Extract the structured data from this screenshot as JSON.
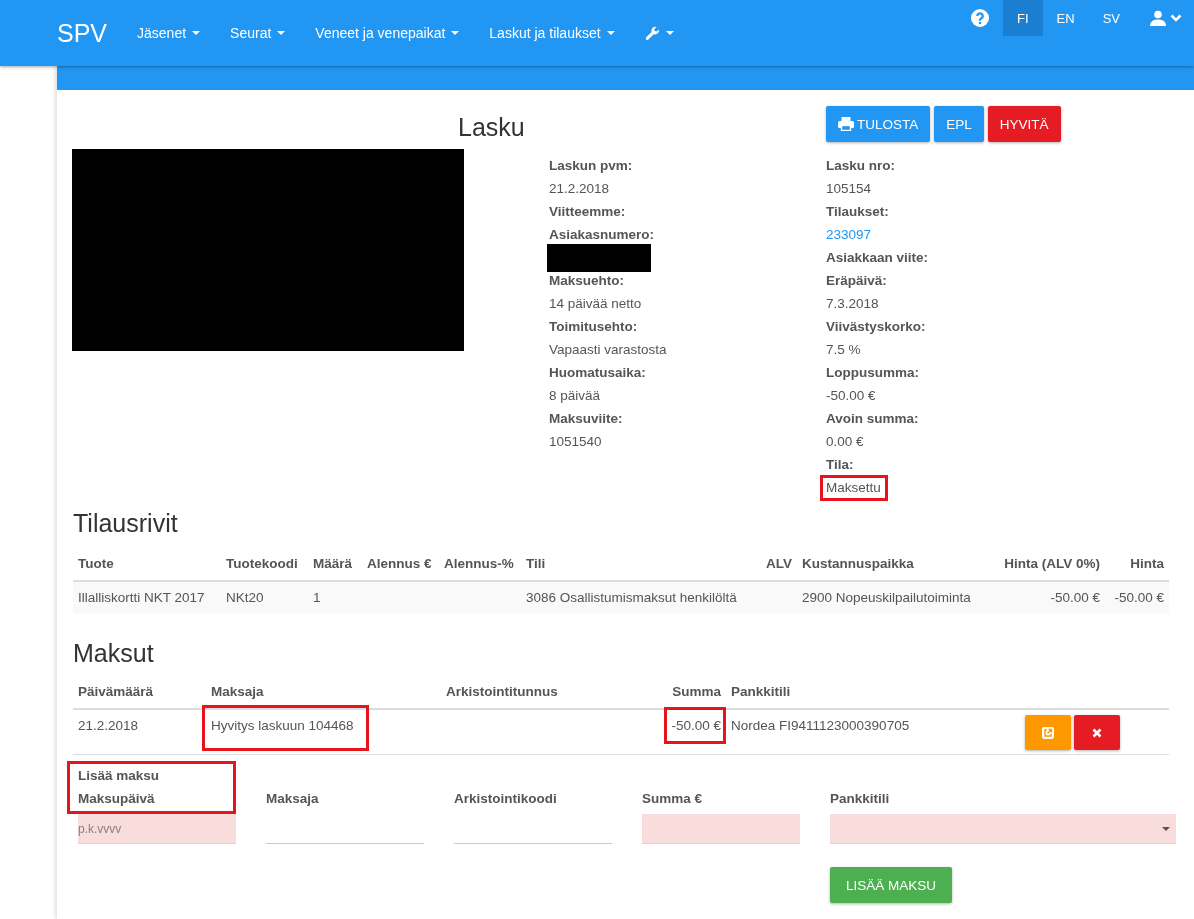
{
  "navbar": {
    "brand": "SPV",
    "menus": [
      {
        "kind": "text",
        "label": "Jäsenet"
      },
      {
        "kind": "text",
        "label": "Seurat"
      },
      {
        "kind": "text",
        "label": "Veneet ja venepaikat"
      },
      {
        "kind": "text",
        "label": "Laskut ja tilaukset"
      },
      {
        "kind": "tools"
      }
    ],
    "languages": [
      {
        "label": "FI",
        "selected": true
      },
      {
        "label": "EN",
        "selected": false
      },
      {
        "label": "SV",
        "selected": false
      }
    ]
  },
  "invoice": {
    "title": "Lasku",
    "address_redacted": true,
    "actions": [
      {
        "kind": "print",
        "label": "TULOSTA"
      },
      {
        "kind": "primary",
        "label": "EPL"
      },
      {
        "kind": "danger",
        "label": "HYVITÄ"
      }
    ],
    "details": [
      [
        {
          "label": "Laskun pvm:",
          "kind": "text",
          "value": "21.2.2018",
          "highlighted": false
        },
        {
          "label": "Viitteemme:",
          "kind": "empty",
          "highlighted": false
        },
        {
          "label": "Asiakasnumero:",
          "kind": "redacted",
          "highlighted": false
        },
        {
          "label": "Maksuehto:",
          "kind": "text",
          "value": "14 päivää netto",
          "highlighted": false
        },
        {
          "label": "Toimitusehto:",
          "kind": "text",
          "value": "Vapaasti varastosta",
          "highlighted": false
        },
        {
          "label": "Huomatusaika:",
          "kind": "text",
          "value": "8 päivää",
          "highlighted": false
        },
        {
          "label": "Maksuviite:",
          "kind": "text",
          "value": "1051540",
          "highlighted": false
        }
      ],
      [
        {
          "label": "Lasku nro:",
          "kind": "text",
          "value": "105154",
          "highlighted": false
        },
        {
          "label": "Tilaukset:",
          "kind": "link",
          "value": "233097",
          "highlighted": false
        },
        {
          "label": "Asiakkaan viite:",
          "kind": "empty",
          "highlighted": false
        },
        {
          "label": "Eräpäivä:",
          "kind": "text",
          "value": "7.3.2018",
          "highlighted": false
        },
        {
          "label": "Viivästyskorko:",
          "kind": "text",
          "value": "7.5 %",
          "highlighted": false
        },
        {
          "label": "Loppusumma:",
          "kind": "text",
          "value": "-50.00 €",
          "highlighted": false
        },
        {
          "label": "Avoin summa:",
          "kind": "text",
          "value": "0.00 €",
          "highlighted": false
        },
        {
          "label": "Tila:",
          "kind": "text",
          "value": "Maksettu",
          "highlighted": true
        }
      ]
    ]
  },
  "order_lines": {
    "title": "Tilausrivit",
    "columns": [
      "Tuote",
      "Tuotekoodi",
      "Määrä",
      "Alennus €",
      "Alennus-%",
      "Tili",
      "ALV",
      "Kustannuspaikka",
      "Hinta (ALV 0%)",
      "Hinta"
    ],
    "rows": [
      {
        "product": "Illalliskortti NKT 2017",
        "product_code": "NKt20",
        "quantity": "1",
        "account": "3086 Osallistumismaksut henkilöltä",
        "cost_center": "2900 Nopeuskilpailutoiminta",
        "price_vat0": "-50.00 €",
        "price": "-50.00 €"
      }
    ]
  },
  "payments": {
    "title": "Maksut",
    "columns": [
      "Päivämäärä",
      "Maksaja",
      "Arkistointitunnus",
      "Summa",
      "Pankkitili"
    ],
    "rows": [
      {
        "date": {
          "text": "21.2.2018",
          "highlighted": false
        },
        "payer": {
          "text": "Hyvitys laskuun 104468",
          "highlighted": true
        },
        "amount": {
          "text": "-50.00 €",
          "highlighted": true
        },
        "bank_account": {
          "text": "Nordea FI9411123000390705",
          "highlighted": false
        },
        "actions": [
          {
            "kind": "edit"
          },
          {
            "kind": "delete"
          }
        ]
      }
    ]
  },
  "add_payment": {
    "title": "Lisää maksu",
    "highlighted": true,
    "fields": [
      {
        "label": "Maksupäivä",
        "kind": "text",
        "placeholder": "p.k.vvvv",
        "invalid": true
      },
      {
        "label": "Maksaja",
        "kind": "text",
        "invalid": false
      },
      {
        "label": "Arkistointikoodi",
        "kind": "text",
        "invalid": false
      },
      {
        "label": "Summa €",
        "kind": "text",
        "invalid": true
      },
      {
        "label": "Pankkitili",
        "kind": "select",
        "invalid": true
      }
    ],
    "submit": "LISÄÄ MAKSU"
  }
}
